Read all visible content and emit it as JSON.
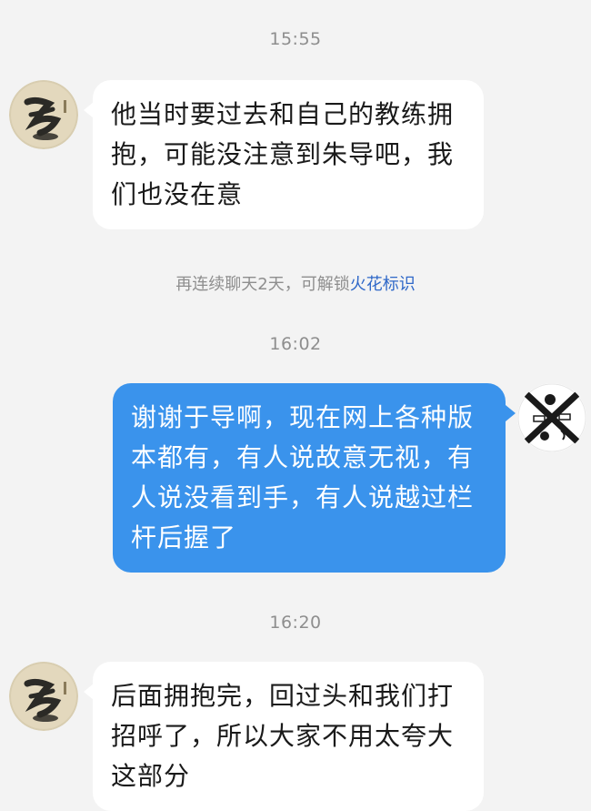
{
  "conversation": {
    "timestamps": [
      "15:55",
      "16:02",
      "16:20"
    ],
    "system_notice": {
      "text": "再连续聊天2天，可解锁",
      "link": "火花标识"
    },
    "messages": [
      {
        "sender": "other",
        "avatar": "calligraphy-avatar",
        "text": "他当时要过去和自己的教练拥抱，可能没注意到朱导吧，我们也没在意"
      },
      {
        "sender": "self",
        "avatar": "crossed-illustration-avatar",
        "text": "谢谢于导啊，现在网上各种版本都有，有人说故意无视，有人说没看到手，有人说越过栏杆后握了"
      },
      {
        "sender": "other",
        "avatar": "calligraphy-avatar",
        "text": "后面拥抱完，回过头和我们打招呼了，所以大家不用太夸大这部分"
      }
    ]
  },
  "colors": {
    "background": "#f3f3f3",
    "incoming_bubble": "#ffffff",
    "outgoing_bubble": "#3a93ec",
    "link": "#2f68c8",
    "muted_text": "#8e8e8e"
  }
}
